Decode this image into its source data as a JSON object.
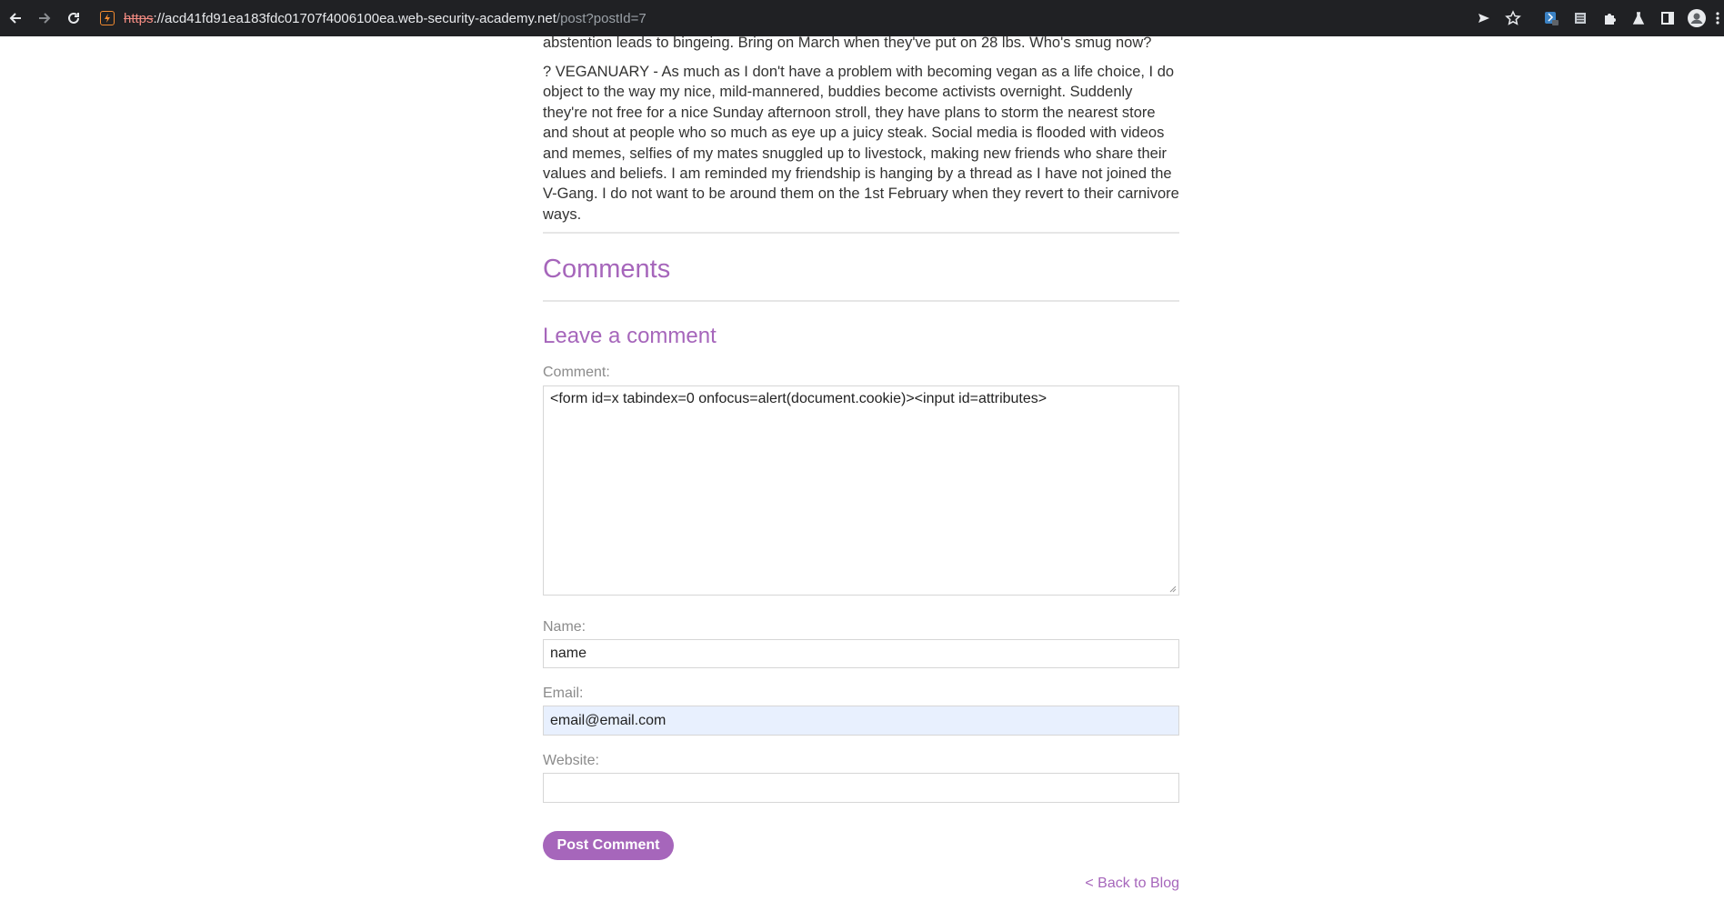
{
  "browser": {
    "url_scheme": "https",
    "url_host": "://acd41fd91ea183fdc01707f4006100ea.web-security-academy.net",
    "url_path": "/post?postId=7",
    "icons": [
      "back-arrow-icon",
      "forward-arrow-icon",
      "reload-icon",
      "not-secure-icon",
      "send-icon",
      "star-icon",
      "extension-icon",
      "reader-icon",
      "puzzle-icon",
      "flask-icon",
      "sidebar-icon",
      "profile-icon",
      "more-icon"
    ]
  },
  "post": {
    "prev_paragraph_tail": "abstention leads to bingeing. Bring on March when they've put on 28 lbs. Who's smug now?",
    "paragraph": "? VEGANUARY - As much as I don't have a problem with becoming vegan as a life choice, I do object to the way my nice, mild-mannered, buddies become activists overnight. Suddenly they're not free for a nice Sunday afternoon stroll, they have plans to storm the nearest store and shout at people who so much as eye up a juicy steak. Social media is flooded with videos and memes, selfies of my mates snuggled up to livestock, making new friends who share their values and beliefs. I am reminded my friendship is hanging by a thread as I have not joined the V-Gang. I do not want to be around them on the 1st February when they revert to their carnivore ways."
  },
  "comments": {
    "heading": "Comments",
    "leave_heading": "Leave a comment",
    "comment_label": "Comment:",
    "comment_value": "<form id=x tabindex=0 onfocus=alert(document.cookie)><input id=attributes>",
    "name_label": "Name:",
    "name_value": "name",
    "email_label": "Email:",
    "email_value": "email@email.com",
    "website_label": "Website:",
    "website_value": "",
    "submit_label": "Post Comment",
    "back_link": "< Back to Blog"
  },
  "colors": {
    "accent": "#a666bb",
    "chrome_bg": "#202124",
    "autofill_bg": "#e8f0fe"
  }
}
